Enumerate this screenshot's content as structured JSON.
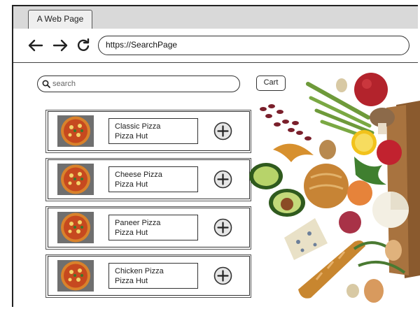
{
  "browser": {
    "tab_title": "A Web Page",
    "url": "https://SearchPage"
  },
  "search": {
    "placeholder": "search"
  },
  "cart": {
    "label": "Cart"
  },
  "products": [
    {
      "name": "Classic Pizza",
      "store": "Pizza Hut"
    },
    {
      "name": "Cheese Pizza",
      "store": "Pizza Hut"
    },
    {
      "name": "Paneer Pizza",
      "store": "Pizza Hut"
    },
    {
      "name": "Chicken Pizza",
      "store": "Pizza Hut"
    }
  ],
  "icons": {
    "back": "arrow-left-icon",
    "forward": "arrow-right-icon",
    "reload": "reload-icon",
    "search": "search-icon",
    "add": "plus-circle-icon",
    "thumbnail": "pizza-image",
    "hero": "groceries-image"
  }
}
